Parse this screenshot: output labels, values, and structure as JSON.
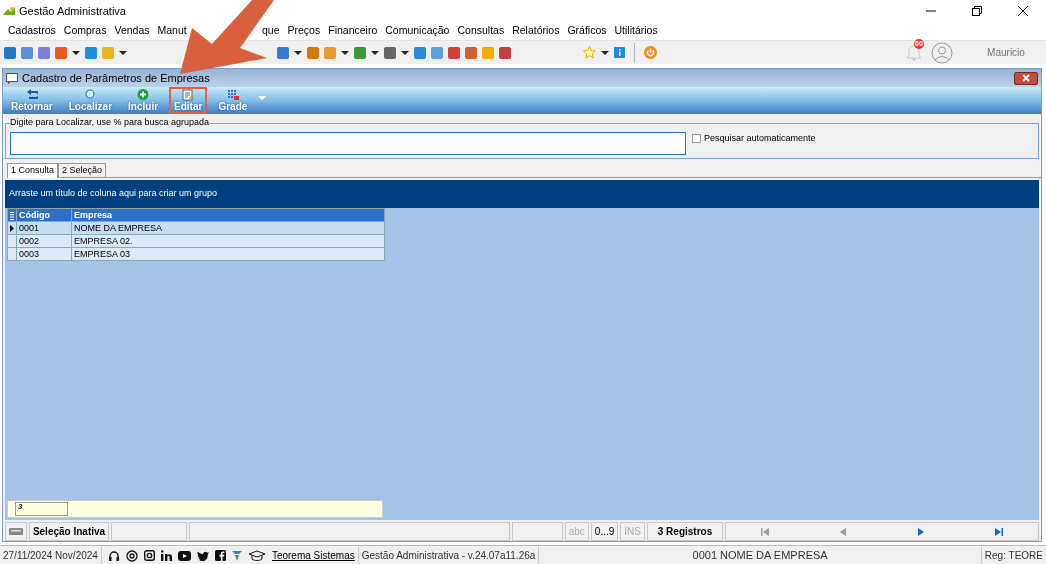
{
  "app_window": {
    "title": "Gestão Administrativa"
  },
  "menu": [
    "Cadastros",
    "Compras",
    "Vendas",
    "Manut",
    "que",
    "Preços",
    "Financeiro",
    "Comunicação",
    "Consultas",
    "Relatórios",
    "Gráficos",
    "Utilitários"
  ],
  "notifications": {
    "badge": "00"
  },
  "user": {
    "name": "Mauricio"
  },
  "child_window": {
    "title": "Cadastro de Parâmetros de Empresas"
  },
  "actions": [
    {
      "kind": "back",
      "label": "Retornar",
      "highlighted": false
    },
    {
      "kind": "search",
      "label": "Localizar",
      "highlighted": false
    },
    {
      "kind": "add",
      "label": "Incluir",
      "highlighted": false
    },
    {
      "kind": "edit",
      "label": "Editar",
      "highlighted": true
    },
    {
      "kind": "grid",
      "label": "Grade",
      "highlighted": false
    }
  ],
  "search": {
    "legend": "Digite para Localizar, use % para busca agrupada",
    "auto_label": "Pesquisar automaticamente",
    "auto_checked": false
  },
  "tabs": [
    {
      "label": "1 Consulta",
      "selected": true
    },
    {
      "label": "2 Seleção",
      "selected": false
    }
  ],
  "grid": {
    "group_hint": "Arraste um título de coluna aqui para criar um grupo",
    "columns": [
      "Código",
      "Empresa"
    ],
    "rows": [
      {
        "cells": [
          "0001",
          "NOME DA EMPRESA"
        ],
        "selected": true
      },
      {
        "cells": [
          "0002",
          "EMPRESA 02."
        ],
        "selected": false
      },
      {
        "cells": [
          "0003",
          "EMPRESA 03"
        ],
        "selected": false
      }
    ],
    "footer_count": "3"
  },
  "status_bar": {
    "selection": "Seleção Inativa",
    "indicators": [
      {
        "label": "abc",
        "disabled": true
      },
      {
        "label": "0...9",
        "disabled": false
      },
      {
        "label": "INS",
        "disabled": true
      }
    ],
    "records": "3 Registros",
    "nav": [
      {
        "kind": "first",
        "disabled": true
      },
      {
        "kind": "prev",
        "disabled": true
      },
      {
        "kind": "next",
        "disabled": false
      },
      {
        "kind": "last",
        "disabled": false
      }
    ]
  },
  "bottom_bar": {
    "date": "27/11/2024 Nov/2024",
    "company_link": "Teorema Sistemas",
    "version": "Gestão Administrativa - v.24.07a11.26a",
    "current_record": "0001 NOME DA EMPRESA",
    "registration": "Reg: TEORE"
  }
}
